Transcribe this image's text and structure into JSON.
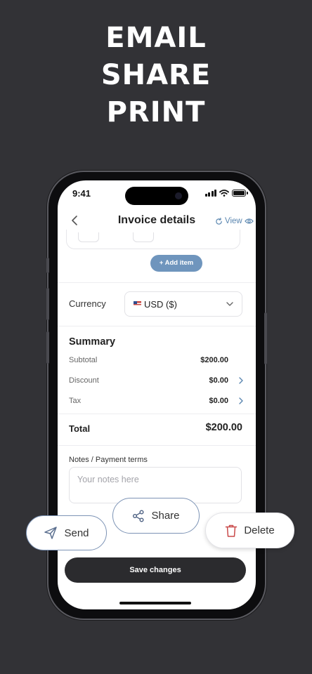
{
  "headline": [
    "EMAIL",
    "SHARE",
    "PRINT"
  ],
  "status": {
    "time": "9:41"
  },
  "nav": {
    "title": "Invoice details",
    "view_label": "View"
  },
  "items": {
    "add_item_label": "+ Add item"
  },
  "currency": {
    "label": "Currency",
    "selected": "USD ($)"
  },
  "summary": {
    "title": "Summary",
    "subtotal_label": "Subtotal",
    "subtotal_value": "$200.00",
    "discount_label": "Discount",
    "discount_value": "$0.00",
    "tax_label": "Tax",
    "tax_value": "$0.00",
    "total_label": "Total",
    "total_value": "$200.00"
  },
  "notes": {
    "label": "Notes / Payment terms",
    "placeholder": "Your notes here"
  },
  "actions": {
    "save_label": "Save changes",
    "send_label": "Send",
    "share_label": "Share",
    "delete_label": "Delete"
  },
  "colors": {
    "background": "#323236",
    "accent": "#6f95bd",
    "link": "#5a86b0",
    "delete": "#c94a4a",
    "primary_button": "#2b2b2e"
  },
  "icons": [
    "back-chevron-icon",
    "refresh-icon",
    "eye-icon",
    "us-flag-icon",
    "chevron-down-icon",
    "chevron-right-icon",
    "send-icon",
    "share-icon",
    "trash-icon"
  ]
}
